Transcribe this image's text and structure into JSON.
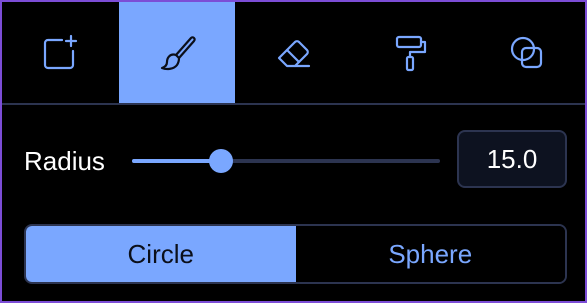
{
  "toolbar": {
    "tools": [
      {
        "icon": "add-layer-icon",
        "active": false
      },
      {
        "icon": "brush-icon",
        "active": true
      },
      {
        "icon": "eraser-icon",
        "active": false
      },
      {
        "icon": "paint-roller-icon",
        "active": false
      },
      {
        "icon": "intersect-icon",
        "active": false
      }
    ]
  },
  "radius": {
    "label": "Radius",
    "value": "15.0",
    "slider_fraction": 0.29
  },
  "shape": {
    "options": [
      "Circle",
      "Sphere"
    ],
    "selected": "Circle"
  },
  "colors": {
    "accent": "#7aa7ff",
    "border_purple": "#7c4dd6",
    "divider": "#2c3450",
    "background": "#000000"
  }
}
